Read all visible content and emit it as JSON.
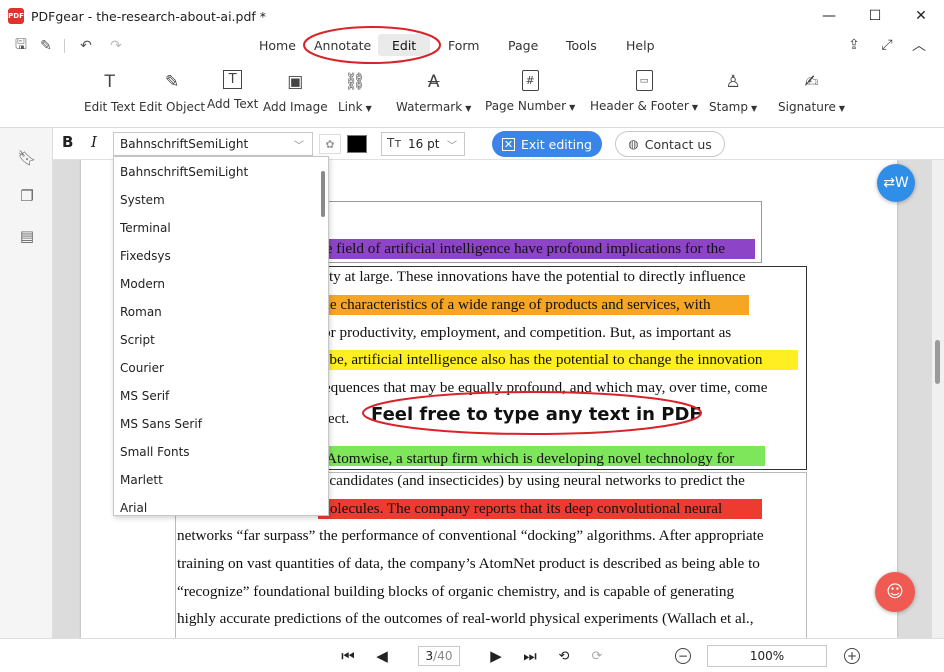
{
  "window": {
    "title": "PDFgear - the-research-about-ai.pdf *",
    "app_logo_text": "PDF",
    "minimize_icon": "minimize-icon",
    "maximize_icon": "maximize-icon",
    "close_icon": "close-icon"
  },
  "menu": {
    "items": [
      "Home",
      "Annotate",
      "Edit",
      "Form",
      "Page",
      "Tools",
      "Help"
    ],
    "active": "Edit"
  },
  "ribbon": {
    "tools": [
      {
        "label": "Edit Text",
        "icon": "edit-text-icon",
        "glyph": "T",
        "dropdown": false
      },
      {
        "label": "Edit Object",
        "icon": "edit-object-icon",
        "glyph": "✎",
        "dropdown": false
      },
      {
        "label": "Add Text",
        "icon": "add-text-icon",
        "glyph": "T",
        "dropdown": false
      },
      {
        "label": "Add Image",
        "icon": "add-image-icon",
        "glyph": "▣",
        "dropdown": false
      },
      {
        "label": "Link",
        "icon": "link-icon",
        "glyph": "⛓",
        "dropdown": true
      },
      {
        "label": "Watermark",
        "icon": "watermark-icon",
        "glyph": "A",
        "dropdown": true
      },
      {
        "label": "Page Number",
        "icon": "page-number-icon",
        "glyph": "#",
        "dropdown": true
      },
      {
        "label": "Header & Footer",
        "icon": "header-footer-icon",
        "glyph": "▭",
        "dropdown": true
      },
      {
        "label": "Stamp",
        "icon": "stamp-icon",
        "glyph": "♙",
        "dropdown": true
      },
      {
        "label": "Signature",
        "icon": "signature-icon",
        "glyph": "✍",
        "dropdown": true
      }
    ]
  },
  "edit_toolbar": {
    "bold_label": "B",
    "italic_label": "I",
    "font_name": "BahnschriftSemiLight",
    "text_color": "#000000",
    "font_size": "16 pt",
    "font_size_icon": "Tт",
    "exit_label": "Exit editing",
    "contact_label": "Contact us"
  },
  "font_dropdown": {
    "options": [
      "BahnschriftSemiLight",
      "System",
      "Terminal",
      "Fixedsys",
      "Modern",
      "Roman",
      "Script",
      "Courier",
      "MS Serif",
      "MS Sans Serif",
      "Small Fonts",
      "Marlett",
      "Arial"
    ]
  },
  "document": {
    "lines": [
      {
        "text": "n",
        "bold": true
      },
      {
        "text": "he field of artificial intelligence have profound implications for the"
      },
      {
        "text": "iety at large.  These innovations have the potential to directly influence"
      },
      {
        "text": " the characteristics of a wide range of products and services, with"
      },
      {
        "text": "for productivity, employment, and competition.  But, as important as"
      },
      {
        "text": "o be, artificial intelligence also has the potential to change the innovation"
      },
      {
        "text": "sequences that may be equally profound, and which may, over time, come"
      },
      {
        "text": "ffect."
      },
      {
        "text": "f Atomwise, a startup firm which is developing novel technology for"
      },
      {
        "text": "g candidates (and insecticides) by using neural networks to predict the"
      },
      {
        "text": "molecules.  The company reports that its deep convolutional neural"
      },
      {
        "text": "networks “far surpass” the performance of conventional “docking” algorithms.  After appropriate"
      },
      {
        "text": "training on vast quantities of data, the company’s AtomNet product is described as being able to"
      },
      {
        "text": "“recognize” foundational building blocks of organic chemistry, and is capable of generating"
      },
      {
        "text": "highly accurate predictions of the outcomes of real-world physical experiments (Wallach et al.,"
      }
    ],
    "inserted_text": "Feel free to type any text in PDF",
    "highlight_colors": {
      "purple": "#8e44c6",
      "orange": "#f5a623",
      "yellow": "#ffee22",
      "green": "#7ee65a",
      "red": "#ee3b30"
    }
  },
  "status": {
    "current_page": "3",
    "total_pages": "/40",
    "zoom": "100%"
  }
}
